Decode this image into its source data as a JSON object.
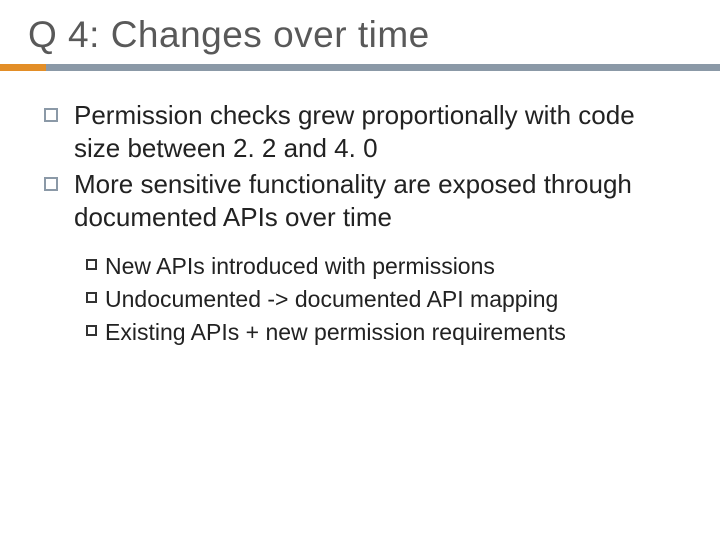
{
  "slide": {
    "title": "Q 4: Changes over time",
    "bullets": [
      {
        "text": "Permission checks grew proportionally with code size between 2. 2 and 4. 0"
      },
      {
        "text": "More sensitive functionality are exposed through documented APIs over time"
      }
    ],
    "subbullets": [
      {
        "lead": "New",
        "rest": " APIs introduced with permissions"
      },
      {
        "lead": "Undocumented",
        "rest": " -> documented API mapping"
      },
      {
        "lead": "Existing",
        "rest": " APIs + new permission requirements"
      }
    ]
  },
  "colors": {
    "accent": "#E38E27",
    "bar": "#8B99A7",
    "title": "#595959"
  }
}
